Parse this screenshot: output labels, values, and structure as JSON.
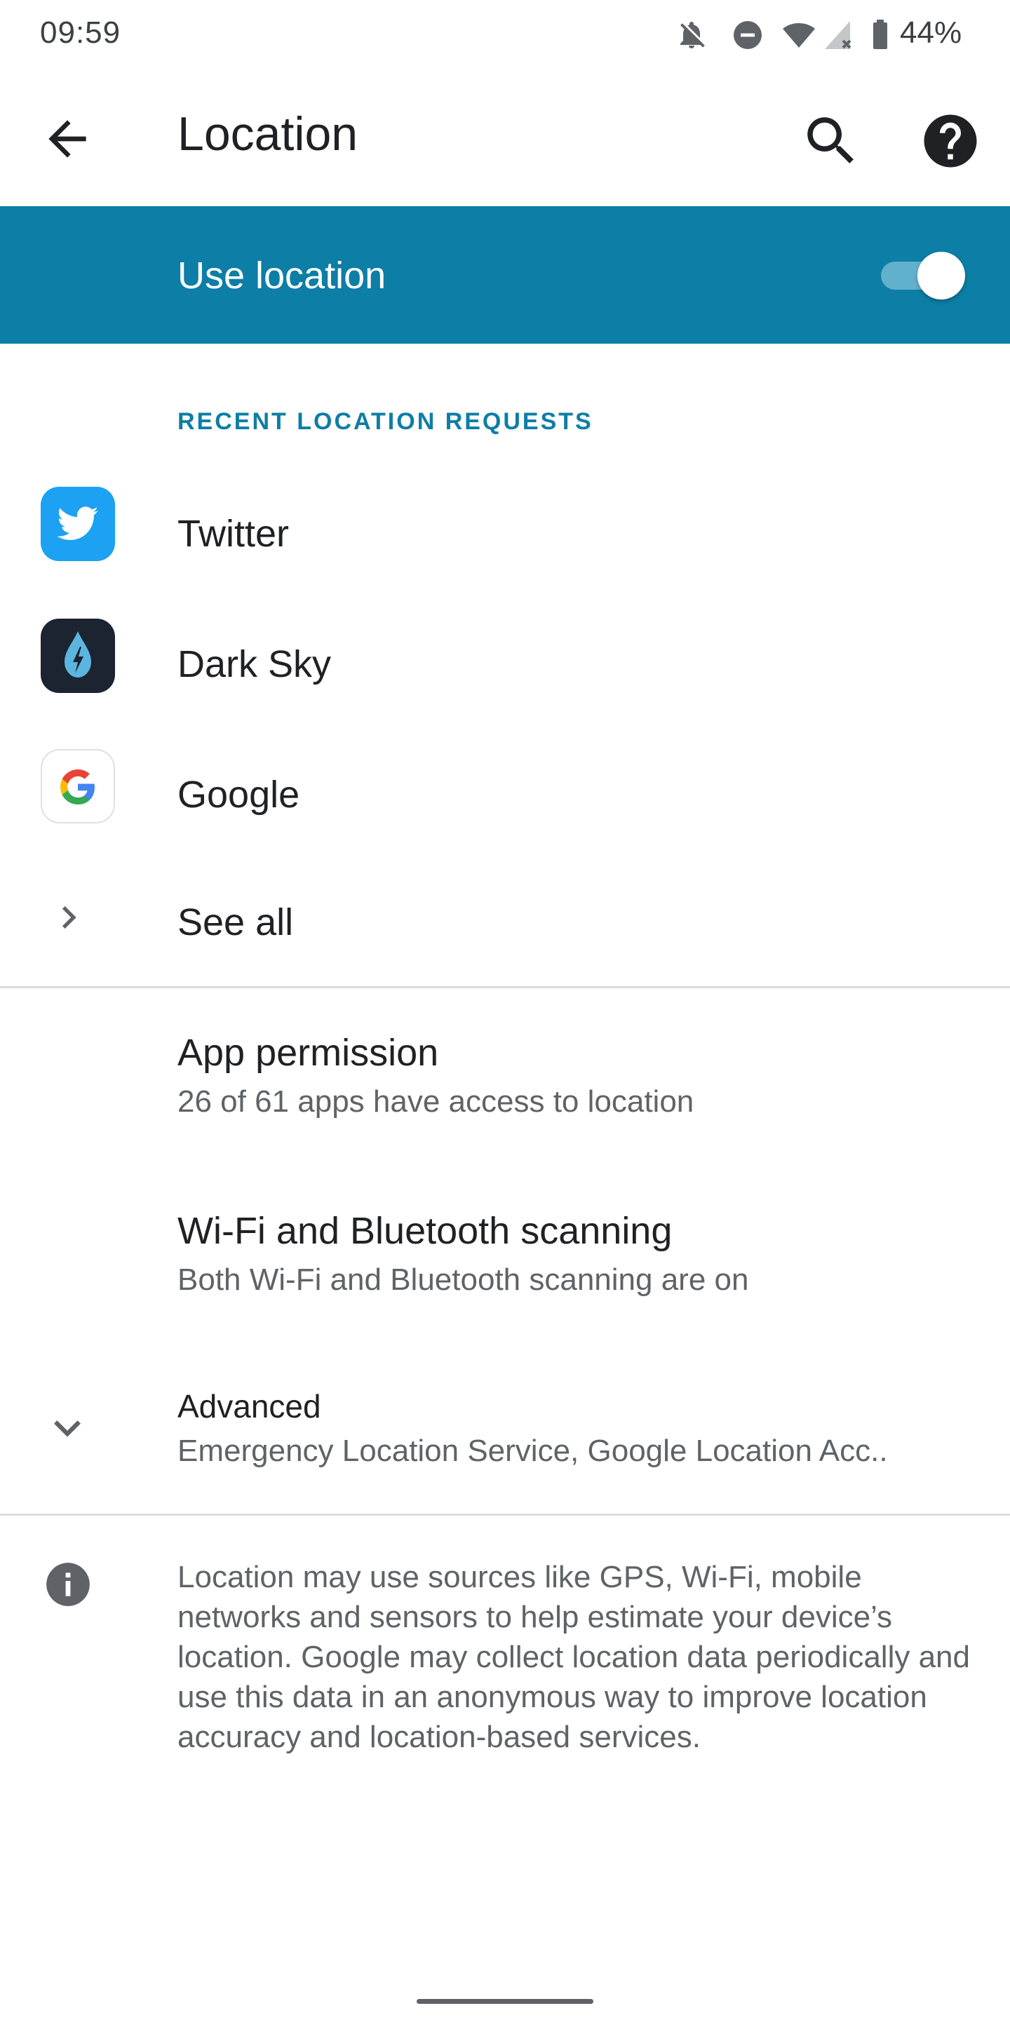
{
  "status_bar": {
    "time": "09:59",
    "battery": "44%",
    "icons": [
      "notifications-off-icon",
      "do-not-disturb-icon",
      "wifi-icon",
      "signal-no-data-icon",
      "battery-icon"
    ]
  },
  "app_bar": {
    "title": "Location",
    "icons": [
      "back-arrow-icon",
      "search-icon",
      "help-icon"
    ]
  },
  "master_switch": {
    "label": "Use location",
    "enabled": true,
    "background": "#0d7ea5"
  },
  "recent_requests": {
    "header": "RECENT LOCATION REQUESTS",
    "apps": [
      {
        "label": "Twitter",
        "icon": "twitter-icon"
      },
      {
        "label": "Dark Sky",
        "icon": "dark-sky-icon"
      },
      {
        "label": "Google",
        "icon": "google-icon"
      }
    ],
    "see_all": "See all"
  },
  "settings": {
    "app_permission": {
      "title": "App permission",
      "subtitle": "26 of 61 apps have access to location"
    },
    "scanning": {
      "title": "Wi-Fi and Bluetooth scanning",
      "subtitle": "Both Wi-Fi and Bluetooth scanning are on"
    },
    "advanced": {
      "title": "Advanced",
      "subtitle": "Emergency Location Service, Google Location Acc.."
    }
  },
  "info": {
    "text": "Location may use sources like GPS, Wi-Fi, mobile networks and sensors to help estimate your device’s location. Google may collect location data periodically and use this data in an anonymous way to improve location accuracy and location-based services."
  },
  "colors": {
    "accent": "#0d7ea5",
    "primary_text": "#202124",
    "secondary_text": "#5f6368"
  }
}
